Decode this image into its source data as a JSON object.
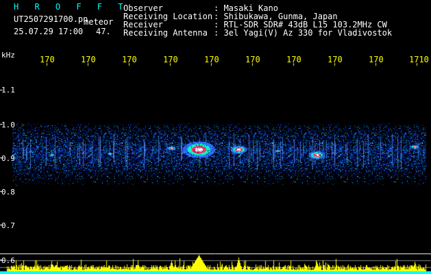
{
  "header": {
    "title": "H R O F F T",
    "filename": "UT2507291700.pn",
    "mode": "meteor",
    "datetime": "25.07.29 17:00",
    "count": "47.",
    "info_labels": [
      "Observer",
      "Receiving Location",
      "Receiver",
      "Receiving Antenna"
    ],
    "info_values": [
      ": Masaki Kano",
      ": Shibukawa, Gunma, Japan",
      ": RTL-SDR SDR# 43dB L15 103.2MHz CW",
      ": 3el Yagi(V) Az 330 for Vladivostok"
    ]
  },
  "axis": {
    "unit": "kHz",
    "y_ticks": [
      "1.1",
      "1.0",
      "0.9",
      "0.8",
      "0.7",
      "0.6"
    ],
    "x_ticks": [
      "170",
      "170",
      "170",
      "170",
      "170",
      "170",
      "170",
      "170",
      "170",
      "1710"
    ]
  },
  "colors": {
    "header_text": "#00ffff",
    "info_text": "#ffffff",
    "tick_text": "#ffff00",
    "signal": "#ffff00",
    "baseline": "#00ffff"
  }
}
